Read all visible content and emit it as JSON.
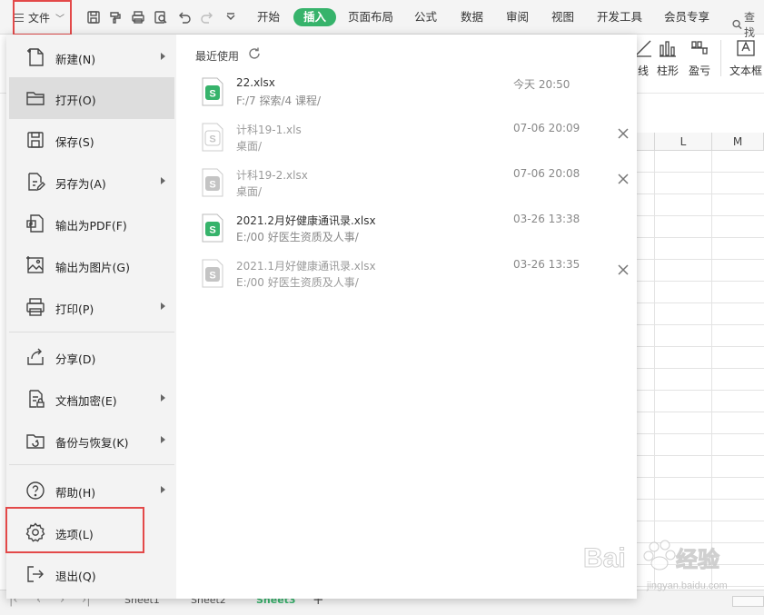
{
  "toolbar": {
    "file_label": "文件",
    "tabs": [
      "开始",
      "插入",
      "页面布局",
      "公式",
      "数据",
      "审阅",
      "视图",
      "开发工具",
      "会员专享"
    ],
    "search_label": "查找",
    "accent_color": "#36b36b",
    "highlight_color": "#e34949"
  },
  "ribbon": {
    "items": [
      "线",
      "柱形",
      "盈亏",
      "文本框"
    ]
  },
  "grid": {
    "columns": [
      "L",
      "M"
    ]
  },
  "sheets": {
    "tabs": [
      "Sheet1",
      "Sheet2",
      "Sheet3"
    ],
    "active": "Sheet3",
    "add_label": "+"
  },
  "file_menu": {
    "items": [
      {
        "label": "新建(N)",
        "icon": "new-document-icon",
        "submenu": true
      },
      {
        "label": "打开(O)",
        "icon": "folder-open-icon",
        "submenu": false,
        "selected": true
      },
      {
        "label": "保存(S)",
        "icon": "save-icon",
        "submenu": false
      },
      {
        "label": "另存为(A)",
        "icon": "save-as-icon",
        "submenu": true
      },
      {
        "label": "输出为PDF(F)",
        "icon": "pdf-icon",
        "submenu": false
      },
      {
        "label": "输出为图片(G)",
        "icon": "image-icon",
        "submenu": false
      },
      {
        "label": "打印(P)",
        "icon": "print-icon",
        "submenu": true
      },
      {
        "label": "分享(D)",
        "icon": "share-icon",
        "submenu": false
      },
      {
        "label": "文档加密(E)",
        "icon": "encrypt-icon",
        "submenu": true
      },
      {
        "label": "备份与恢复(K)",
        "icon": "backup-icon",
        "submenu": true
      },
      {
        "label": "帮助(H)",
        "icon": "help-icon",
        "submenu": true
      },
      {
        "label": "选项(L)",
        "icon": "gear-icon",
        "submenu": false,
        "highlighted": true
      },
      {
        "label": "退出(Q)",
        "icon": "exit-icon",
        "submenu": false
      }
    ]
  },
  "recent": {
    "title": "最近使用",
    "files": [
      {
        "name": "22.xlsx",
        "path": "F:/7 探索/4 课程/",
        "time": "今天 20:50",
        "available": true,
        "closable": false
      },
      {
        "name": "计科19-1.xls",
        "path": "桌面/",
        "time": "07-06 20:09",
        "available": false,
        "closable": true
      },
      {
        "name": "计科19-2.xlsx",
        "path": "桌面/",
        "time": "07-06 20:08",
        "available": false,
        "closable": true
      },
      {
        "name": "2021.2月好健康通讯录.xlsx",
        "path": "E:/00 好医生资质及人事/",
        "time": "03-26 13:38",
        "available": true,
        "closable": false
      },
      {
        "name": "2021.1月好健康通讯录.xlsx",
        "path": "E:/00 好医生资质及人事/",
        "time": "03-26 13:35",
        "available": false,
        "closable": true
      }
    ]
  },
  "watermark": {
    "brand": "Bai",
    "brand_suffix": "经验",
    "url": "jingyan.baidu.com"
  }
}
